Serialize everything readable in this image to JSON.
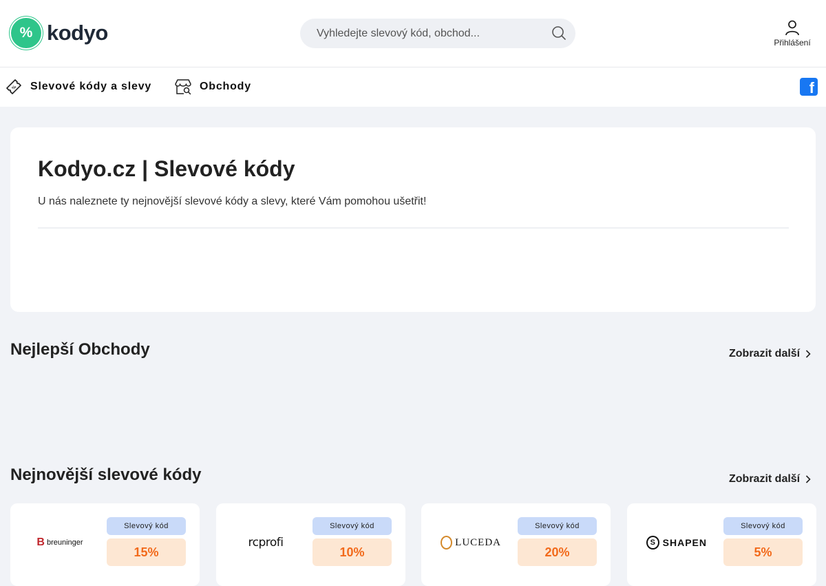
{
  "logo": {
    "text": "kodyo",
    "mark": "%"
  },
  "search": {
    "placeholder": "Vyhledejte slevový kód, obchod..."
  },
  "login": {
    "label": "Přihlášení"
  },
  "nav": {
    "coupons_label": "Slevové kódy a slevy",
    "shops_label": "Obchody"
  },
  "hero": {
    "title": "Kodyo.cz | Slevové kódy",
    "subtitle": "U nás naleznete ty nejnovější slevové kódy a slevy, které Vám pomohou ušetřit!"
  },
  "top_shops": {
    "title": "Nejlepší Obchody",
    "more_label": "Zobrazit další"
  },
  "latest": {
    "title": "Nejnovější slevové kódy",
    "more_label": "Zobrazit další",
    "cards": [
      {
        "brand": "breuninger",
        "type": "Slevový kód",
        "discount": "15%"
      },
      {
        "brand": "rcprofi",
        "type": "Slevový kód",
        "discount": "10%"
      },
      {
        "brand": "LUCEDA",
        "type": "Slevový kód",
        "discount": "20%"
      },
      {
        "brand": "SHAPEN",
        "type": "Slevový kód",
        "discount": "5%"
      }
    ]
  },
  "colors": {
    "brand_green": "#2ec58a",
    "badge_blue": "#c9daf9",
    "discount_bg": "#fde7d3",
    "discount_text": "#f26a1b",
    "facebook": "#1877f2"
  }
}
